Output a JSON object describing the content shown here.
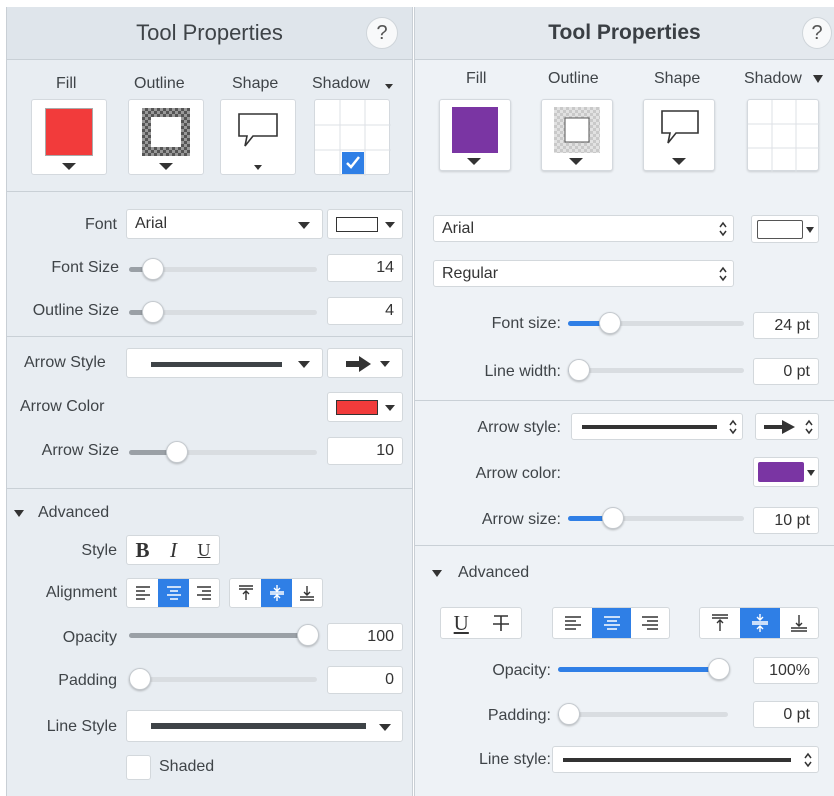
{
  "left": {
    "header": {
      "title": "Tool Properties",
      "help": "?"
    },
    "swatches": {
      "fill": "Fill",
      "outline": "Outline",
      "shape": "Shape",
      "shadow": "Shadow"
    },
    "font": {
      "label": "Font",
      "value": "Arial"
    },
    "font_size": {
      "label": "Font Size",
      "value": "14"
    },
    "outline_size": {
      "label": "Outline Size",
      "value": "4"
    },
    "arrow_style": {
      "label": "Arrow Style"
    },
    "arrow_color": {
      "label": "Arrow Color"
    },
    "arrow_size": {
      "label": "Arrow Size",
      "value": "10"
    },
    "advanced": {
      "label": "Advanced"
    },
    "style": {
      "label": "Style",
      "bold": "B",
      "italic": "I",
      "underline": "U"
    },
    "alignment": {
      "label": "Alignment"
    },
    "opacity": {
      "label": "Opacity",
      "value": "100"
    },
    "padding": {
      "label": "Padding",
      "value": "0"
    },
    "line_style": {
      "label": "Line Style"
    },
    "shaded": {
      "label": "Shaded"
    }
  },
  "right": {
    "header": {
      "title": "Tool Properties",
      "help": "?"
    },
    "swatches": {
      "fill": "Fill",
      "outline": "Outline",
      "shape": "Shape",
      "shadow": "Shadow"
    },
    "font": {
      "value": "Arial"
    },
    "font_weight": {
      "value": "Regular"
    },
    "font_size": {
      "label": "Font size:",
      "value": "24 pt"
    },
    "line_width": {
      "label": "Line width:",
      "value": "0 pt"
    },
    "arrow_style": {
      "label": "Arrow style:"
    },
    "arrow_color": {
      "label": "Arrow color:"
    },
    "arrow_size": {
      "label": "Arrow size:",
      "value": "10 pt"
    },
    "advanced": {
      "label": "Advanced"
    },
    "style": {
      "underline": "U"
    },
    "opacity": {
      "label": "Opacity:",
      "value": "100%"
    },
    "padding": {
      "label": "Padding:",
      "value": "0 pt"
    },
    "line_style": {
      "label": "Line style:"
    }
  },
  "colors": {
    "left_fill": "#f23b3b",
    "left_arrow": "#f23b3b",
    "right_fill": "#7a35a3",
    "right_arrow": "#7a35a3",
    "accent": "#2f7fe6"
  },
  "levels": {
    "left_font_size": 0.08,
    "left_outline_size": 0.08,
    "left_arrow_size": 0.22,
    "left_opacity": 1.0,
    "left_padding": 0.0,
    "right_font_size": 0.2,
    "right_line_width": 0.0,
    "right_arrow_size": 0.22,
    "right_opacity": 1.0,
    "right_padding": 0.0
  },
  "icons": {
    "help": "help-icon",
    "dropdown": "chevron-down-icon",
    "stepper": "stepper-icon",
    "arrow": "arrow-right-icon",
    "disclosure": "disclosure-triangle-icon",
    "callout": "callout-shape-icon",
    "grid": "shadow-grid-icon",
    "checkmark": "checkmark-icon"
  }
}
